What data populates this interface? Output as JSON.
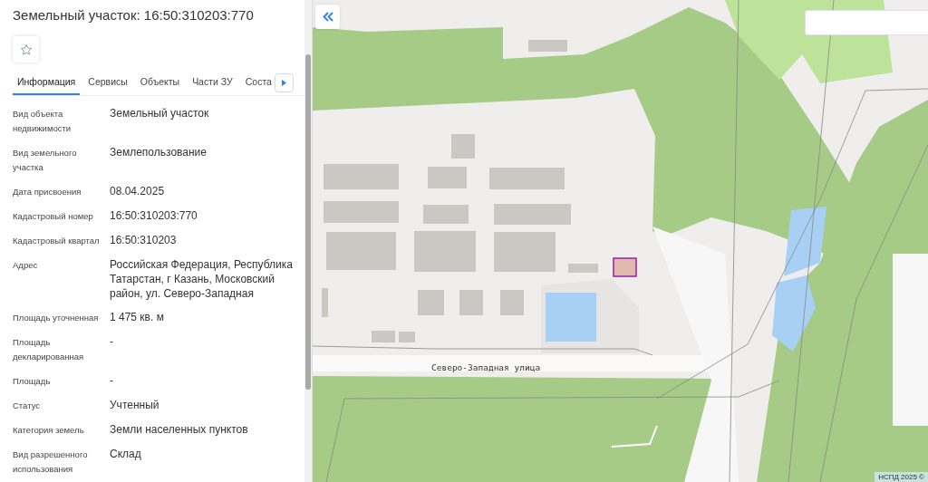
{
  "panel": {
    "title": "Земельный участок: 16:50:310203:770",
    "tabs": [
      {
        "label": "Информация",
        "selected": true
      },
      {
        "label": "Сервисы",
        "selected": false
      },
      {
        "label": "Объекты",
        "selected": false
      },
      {
        "label": "Части ЗУ",
        "selected": false
      },
      {
        "label": "Соста",
        "selected": false
      }
    ],
    "fields": [
      {
        "label": "Вид объекта недвижимости",
        "value": "Земельный участок"
      },
      {
        "label": "Вид земельного участка",
        "value": "Землепользование"
      },
      {
        "label": "Дата присвоения",
        "value": "08.04.2025"
      },
      {
        "label": "Кадастровый номер",
        "value": "16:50:310203:770"
      },
      {
        "label": "Кадастровый квартал",
        "value": "16:50:310203"
      },
      {
        "label": "Адрес",
        "value": "Российская Федерация, Республика Татарстан, г Казань, Московский район, ул. Северо-Западная"
      },
      {
        "label": "Площадь уточненная",
        "value": "1 475 кв. м"
      },
      {
        "label": "Площадь декларированная",
        "value": "-"
      },
      {
        "label": "Площадь",
        "value": "-"
      },
      {
        "label": "Статус",
        "value": "Учтенный"
      },
      {
        "label": "Категория земель",
        "value": "Земли населенных пунктов"
      },
      {
        "label": "Вид разрешенного использования",
        "value": "Склад"
      }
    ]
  },
  "map": {
    "street_label": "Северо-Западная улица",
    "attribution": "НСПД 2025 ©"
  }
}
